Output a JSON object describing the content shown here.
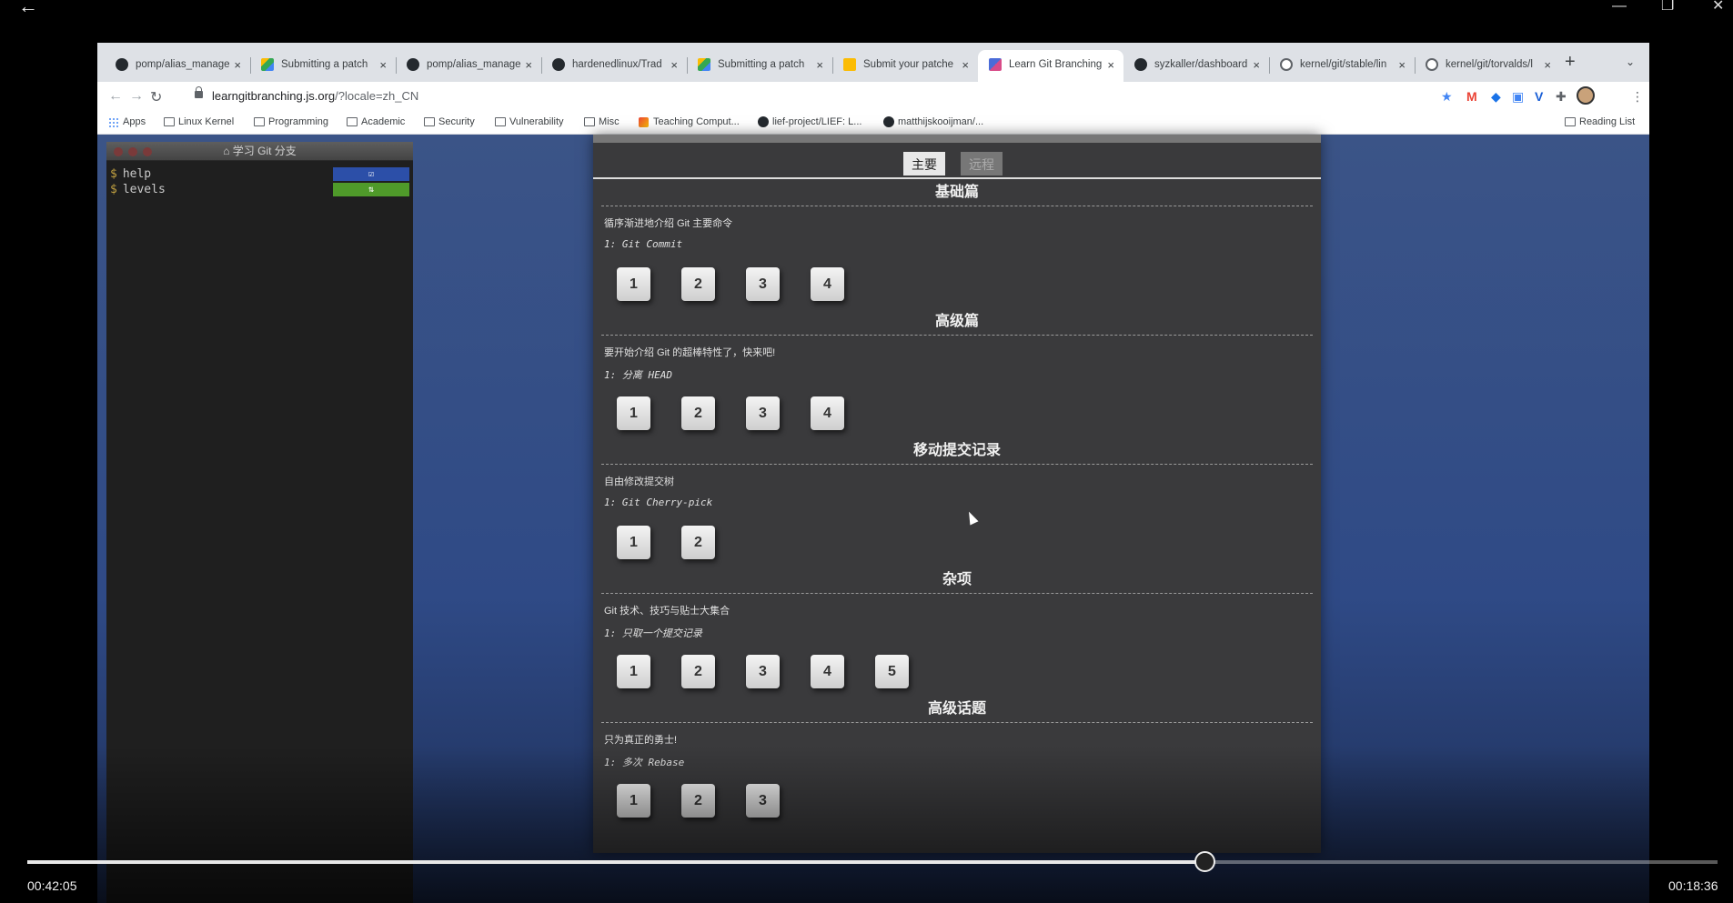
{
  "player": {
    "back_icon": "←",
    "controls": {
      "minimize": "—",
      "restore": "❐",
      "close": "✕"
    },
    "elapsed": "00:42:05",
    "remaining": "00:18:36",
    "progress_fraction": 0.6965
  },
  "browser": {
    "tabs": [
      {
        "label": "pomp/alias_manage",
        "icon": "github",
        "active": false
      },
      {
        "label": "Submitting a patch",
        "icon": "drive",
        "active": false
      },
      {
        "label": "pomp/alias_manage",
        "icon": "github",
        "active": false
      },
      {
        "label": "hardenedlinux/Trad",
        "icon": "github",
        "active": false
      },
      {
        "label": "Submitting a patch",
        "icon": "drive",
        "active": false
      },
      {
        "label": "Submit your patche",
        "icon": "slides",
        "active": false
      },
      {
        "label": "Learn Git Branching",
        "icon": "lgb",
        "active": true
      },
      {
        "label": "syzkaller/dashboard",
        "icon": "github",
        "active": false
      },
      {
        "label": "kernel/git/stable/lin",
        "icon": "globe",
        "active": false
      },
      {
        "label": "kernel/git/torvalds/l",
        "icon": "globe",
        "active": false
      }
    ],
    "tab_close": "×",
    "new_tab": "+",
    "tab_menu": "⌄",
    "nav": {
      "back": "←",
      "forward": "→",
      "reload": "↻"
    },
    "url_host": "learngitbranching.js.org",
    "url_rest": "/?locale=zh_CN",
    "bookmarks": [
      {
        "label": "Apps",
        "icon": "apps"
      },
      {
        "label": "Linux Kernel",
        "icon": "folder"
      },
      {
        "label": "Programming",
        "icon": "folder"
      },
      {
        "label": "Academic",
        "icon": "folder"
      },
      {
        "label": "Security",
        "icon": "folder"
      },
      {
        "label": "Vulnerability",
        "icon": "folder"
      },
      {
        "label": "Misc",
        "icon": "folder"
      },
      {
        "label": "Teaching Comput...",
        "icon": "teaching"
      },
      {
        "label": "lief-project/LIEF: L...",
        "icon": "github"
      },
      {
        "label": "matthijskooijman/...",
        "icon": "github"
      }
    ],
    "reading_list": "Reading List"
  },
  "terminal": {
    "title": "学习 Git 分支",
    "lines": [
      {
        "prompt": "$",
        "command": "help"
      },
      {
        "prompt": "$",
        "command": "levels"
      }
    ]
  },
  "levels_dialog": {
    "tabs": {
      "main": "主要",
      "remote": "远程"
    },
    "sections": [
      {
        "title": "基础篇",
        "desc": "循序渐进地介绍 Git 主要命令",
        "sequence": "1: Git Commit",
        "levels": [
          "1",
          "2",
          "3",
          "4"
        ]
      },
      {
        "title": "高级篇",
        "desc": "要开始介绍 Git 的超棒特性了，快来吧!",
        "sequence": "1: 分离 HEAD",
        "levels": [
          "1",
          "2",
          "3",
          "4"
        ]
      },
      {
        "title": "移动提交记录",
        "desc": "自由修改提交树",
        "sequence": "1: Git Cherry-pick",
        "levels": [
          "1",
          "2"
        ]
      },
      {
        "title": "杂项",
        "desc": "Git 技术、技巧与贴士大集合",
        "sequence": "1: 只取一个提交记录",
        "levels": [
          "1",
          "2",
          "3",
          "4",
          "5"
        ]
      },
      {
        "title": "高级话题",
        "desc": "只为真正的勇士!",
        "sequence": "1: 多次 Rebase",
        "levels": [
          "1",
          "2",
          "3"
        ]
      }
    ]
  },
  "colors": {
    "help_tag": "#2c4fa8",
    "levels_tag": "#4f9a2a",
    "page_background": "#2f4a86",
    "dialog_background": "#3a3a3c"
  }
}
